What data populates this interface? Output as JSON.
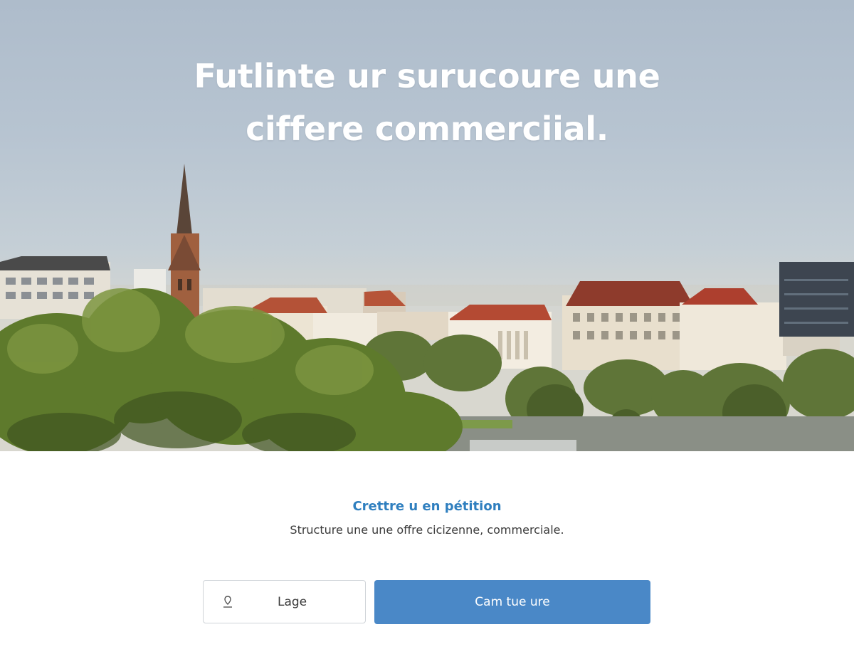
{
  "hero": {
    "headline": "Futlinte ur surucoure une ciffere commerciial.",
    "image": "city-skyline-photo"
  },
  "form": {
    "title": "Crettre u en pétition",
    "description": "Structure une une offre cicizenne, commerciale.",
    "input_value": "Lage",
    "input_icon": "pin-icon",
    "submit_label": "Cam tue ure"
  },
  "colors": {
    "accent": "#2f7fbf",
    "button": "#4a88c7",
    "text": "#3a3a3a"
  }
}
